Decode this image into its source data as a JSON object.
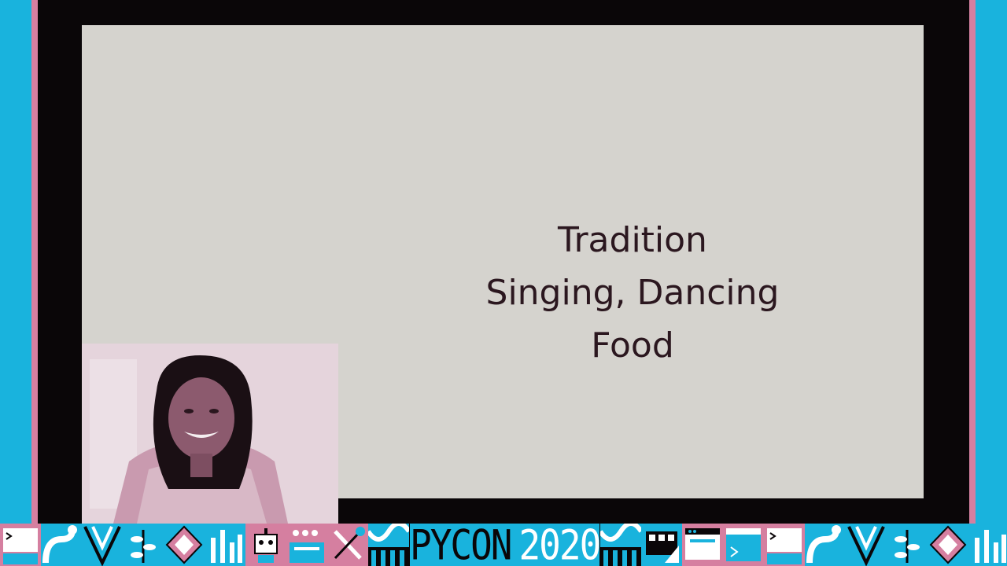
{
  "slide": {
    "lines": [
      "Tradition",
      "Singing, Dancing",
      "Food"
    ]
  },
  "footer": {
    "brand_word": "PYCON",
    "brand_year": "2020",
    "left_tiles": [
      "terminal-icon",
      "snake-icon",
      "chevron-icon",
      "leaf-icon",
      "diamond-icon",
      "bars-icon",
      "robot-icon",
      "keyboard-icon",
      "tools-icon",
      "wave-icon"
    ],
    "right_tiles": [
      "wave-icon",
      "shapes-icon",
      "window-icon",
      "browser-icon",
      "terminal-icon",
      "snake-icon",
      "chevron-icon",
      "leaf-icon",
      "diamond-icon",
      "bars-icon",
      "robot-icon"
    ]
  },
  "colors": {
    "frame": "#19b3dd",
    "stripe": "#d57fa0",
    "background": "#0a0608",
    "slide": "#d5d3ce",
    "slide_text": "#2b171f"
  }
}
